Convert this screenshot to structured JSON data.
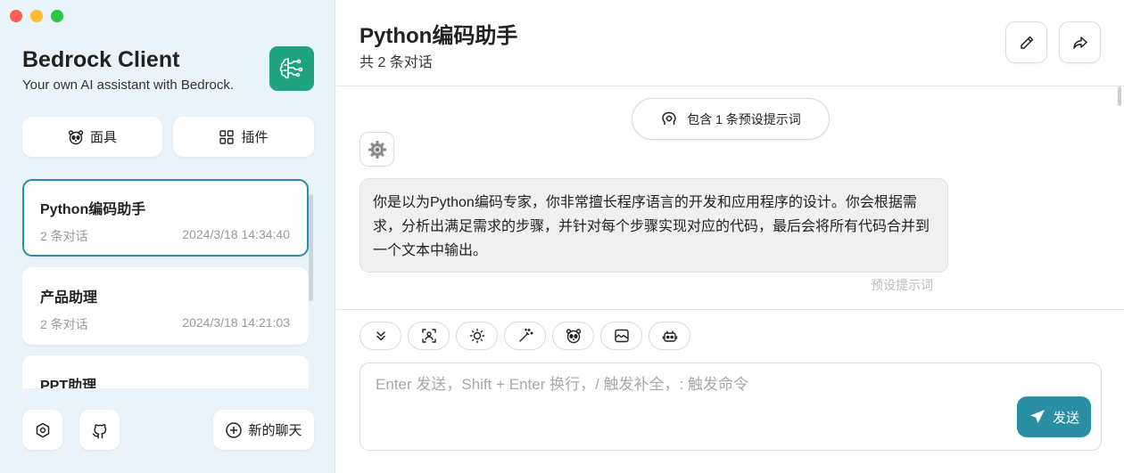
{
  "colors": {
    "accent": "#2a8fa2",
    "sidebar_bg": "#e8f4fa",
    "logo_bg": "#1ea27f",
    "bubble_bg": "#f0f0f0"
  },
  "sidebar": {
    "app_title": "Bedrock Client",
    "app_subtitle": "Your own AI assistant with Bedrock.",
    "logo_icon": "brain-circuit-icon",
    "mask_button": {
      "label": "面具",
      "icon": "panda-face-icon"
    },
    "plugin_button": {
      "label": "插件",
      "icon": "grid-icon"
    },
    "chats": [
      {
        "title": "Python编码助手",
        "count": "2 条对话",
        "time": "2024/3/18 14:34:40",
        "active": true
      },
      {
        "title": "产品助理",
        "count": "2 条对话",
        "time": "2024/3/18 14:21:03",
        "active": false
      },
      {
        "title": "PPT助理",
        "count": "",
        "time": "",
        "active": false
      }
    ],
    "settings_icon": "settings-hexagon-icon",
    "github_icon": "github-icon",
    "new_chat_label": "新的聊天"
  },
  "main": {
    "title": "Python编码助手",
    "subtitle": "共 2 条对话",
    "edit_icon": "pencil-icon",
    "share_icon": "share-arrow-icon",
    "prompt_pill": "包含 1 条预设提示词",
    "message": {
      "text": "你是以为Python编码专家，你非常擅长程序语言的开发和应用程序的设计。你会根据需求，分析出满足需求的步骤，并针对每个步骤实现对应的代码，最后会将所有代码合并到一个文本中输出。",
      "tag": "预设提示词"
    },
    "toolbar_icons": [
      "chevrons-down-icon",
      "image-scan-icon",
      "sun-icon",
      "magic-wand-icon",
      "panda-face-icon",
      "image-icon",
      "robot-icon"
    ],
    "input": {
      "placeholder": "Enter 发送，Shift + Enter 换行，/ 触发补全，: 触发命令",
      "value": ""
    },
    "send_label": "发送"
  }
}
